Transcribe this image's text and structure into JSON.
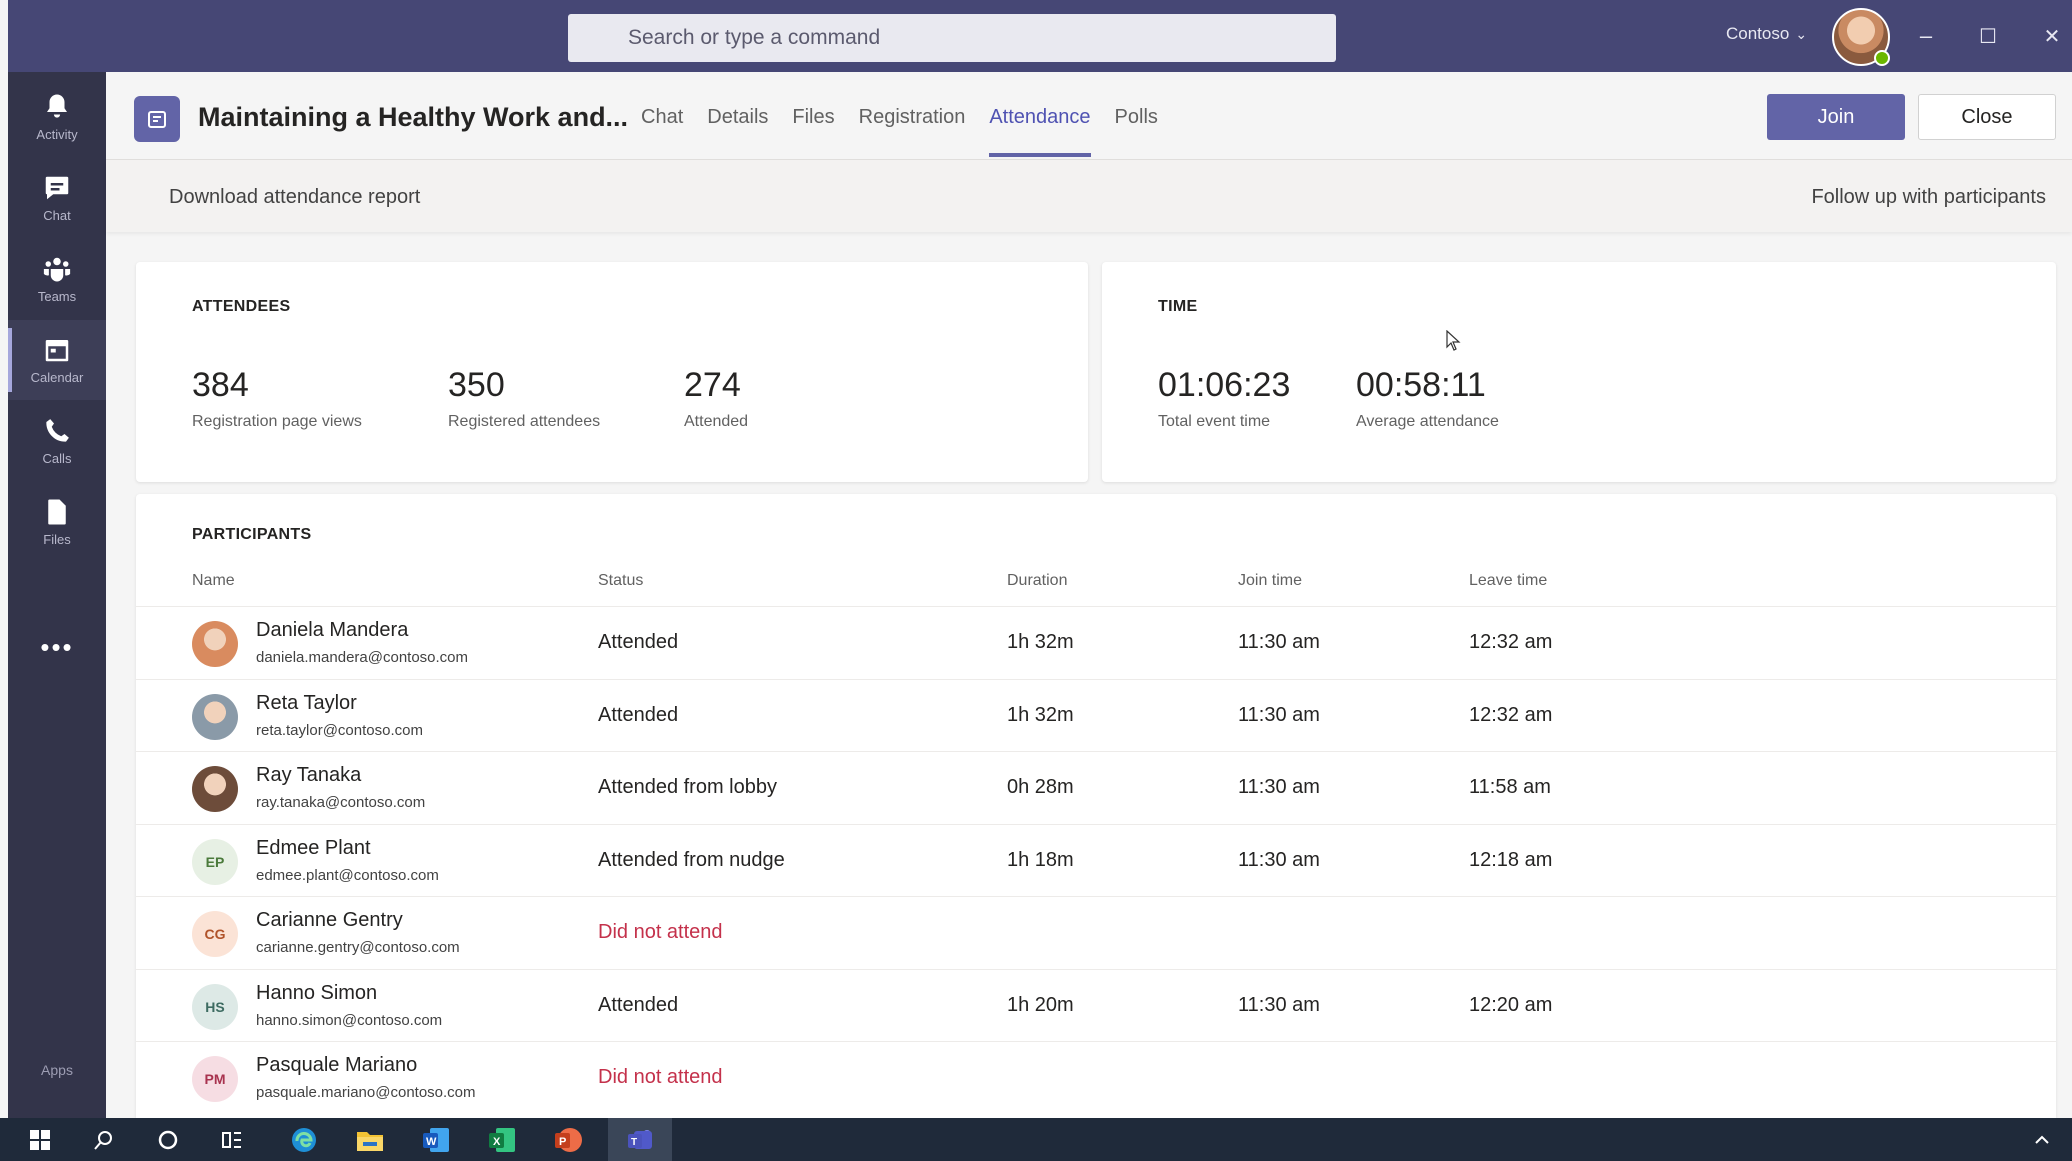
{
  "titlebar": {
    "search_placeholder": "Search or type a command",
    "org": "Contoso",
    "org_chevron": "⌄",
    "minimize": "–",
    "maximize": "☐",
    "close": "✕"
  },
  "rail": {
    "items": [
      {
        "label": "Activity",
        "icon": "bell-icon"
      },
      {
        "label": "Chat",
        "icon": "chat-icon"
      },
      {
        "label": "Teams",
        "icon": "teams-icon"
      },
      {
        "label": "Calendar",
        "icon": "calendar-icon",
        "active": true
      },
      {
        "label": "Calls",
        "icon": "phone-icon"
      },
      {
        "label": "Files",
        "icon": "file-icon"
      }
    ],
    "more": "•••",
    "apps": "Apps"
  },
  "header": {
    "title": "Maintaining a Healthy Work and...",
    "tabs": [
      "Chat",
      "Details",
      "Files",
      "Registration",
      "Attendance",
      "Polls"
    ],
    "active_tab": "Attendance",
    "join_label": "Join",
    "close_label": "Close"
  },
  "toolbar": {
    "download": "Download attendance report",
    "followup": "Follow up with participants"
  },
  "attendees": {
    "title": "ATTENDEES",
    "stats": [
      {
        "value": "384",
        "label": "Registration page views"
      },
      {
        "value": "350",
        "label": "Registered attendees"
      },
      {
        "value": "274",
        "label": "Attended"
      }
    ]
  },
  "time": {
    "title": "TIME",
    "stats": [
      {
        "value": "01:06:23",
        "label": "Total event time"
      },
      {
        "value": "00:58:11",
        "label": "Average attendance"
      }
    ]
  },
  "participants": {
    "title": "PARTICIPANTS",
    "columns": [
      "Name",
      "Status",
      "Duration",
      "Join time",
      "Leave time"
    ],
    "rows": [
      {
        "name": "Daniela Mandera",
        "email": "daniela.mandera@contoso.com",
        "status": "Attended",
        "duration": "1h 32m",
        "join": "11:30 am",
        "leave": "12:32 am",
        "initials": "",
        "avatar_color": "#d98b5f"
      },
      {
        "name": "Reta Taylor",
        "email": "reta.taylor@contoso.com",
        "status": "Attended",
        "duration": "1h 32m",
        "join": "11:30 am",
        "leave": "12:32 am",
        "initials": "",
        "avatar_color": "#8a9aa8"
      },
      {
        "name": "Ray Tanaka",
        "email": "ray.tanaka@contoso.com",
        "status": "Attended from lobby",
        "duration": "0h 28m",
        "join": "11:30 am",
        "leave": "11:58 am",
        "initials": "",
        "avatar_color": "#6d4c3a"
      },
      {
        "name": "Edmee Plant",
        "email": "edmee.plant@contoso.com",
        "status": "Attended from nudge",
        "duration": "1h 18m",
        "join": "11:30 am",
        "leave": "12:18 am",
        "initials": "EP",
        "avatar_color": "#e7f0e4",
        "initials_color": "#4b7a3b"
      },
      {
        "name": "Carianne Gentry",
        "email": "carianne.gentry@contoso.com",
        "status": "Did not attend",
        "duration": "",
        "join": "",
        "leave": "",
        "initials": "CG",
        "avatar_color": "#fbe3d6",
        "initials_color": "#b0532a"
      },
      {
        "name": "Hanno Simon",
        "email": "hanno.simon@contoso.com",
        "status": "Attended",
        "duration": "1h 20m",
        "join": "11:30 am",
        "leave": "12:20 am",
        "initials": "HS",
        "avatar_color": "#dde9e6",
        "initials_color": "#3d6b61"
      },
      {
        "name": "Pasquale Mariano",
        "email": "pasquale.mariano@contoso.com",
        "status": "Did not attend",
        "duration": "",
        "join": "",
        "leave": "",
        "initials": "PM",
        "avatar_color": "#f6dde3",
        "initials_color": "#a8334f"
      }
    ]
  },
  "colors": {
    "brand": "#6264a7",
    "titlebar": "#464775",
    "rail": "#33344a",
    "did_not_attend": "#c4314b"
  }
}
